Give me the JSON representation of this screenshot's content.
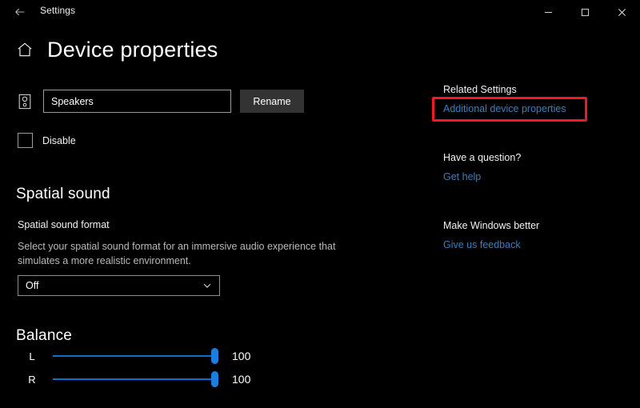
{
  "titlebar": {
    "back_icon": "back-arrow-icon",
    "title": "Settings",
    "minimize_label": "Minimize",
    "maximize_label": "Maximize",
    "close_label": "Close"
  },
  "header": {
    "home_icon": "home-icon",
    "title": "Device properties"
  },
  "device": {
    "icon": "speaker-icon",
    "name_value": "Speakers",
    "name_placeholder": "Speakers",
    "rename_label": "Rename",
    "disable_label": "Disable",
    "disable_checked": false
  },
  "spatial_sound": {
    "heading": "Spatial sound",
    "sub_label": "Spatial sound format",
    "description": "Select your spatial sound format for an immersive audio experience that simulates a more realistic environment.",
    "selected_value": "Off",
    "chevron_icon": "chevron-down-icon"
  },
  "balance": {
    "heading": "Balance",
    "channels": [
      {
        "side": "L",
        "value": "100"
      },
      {
        "side": "R",
        "value": "100"
      }
    ]
  },
  "related": {
    "sections": [
      {
        "heading": "Related Settings",
        "link": "Additional device properties"
      },
      {
        "heading": "Have a question?",
        "link": "Get help"
      },
      {
        "heading": "Make Windows better",
        "link": "Give us feedback"
      }
    ]
  },
  "annotation": {
    "color": "#ee1b24",
    "target": "Additional device properties"
  },
  "colors": {
    "background": "#000000",
    "accent_blue": "#1a7fe0",
    "link_blue": "#3a7ebf",
    "button_gray": "#333333",
    "annotation_red": "#ee1b24"
  }
}
